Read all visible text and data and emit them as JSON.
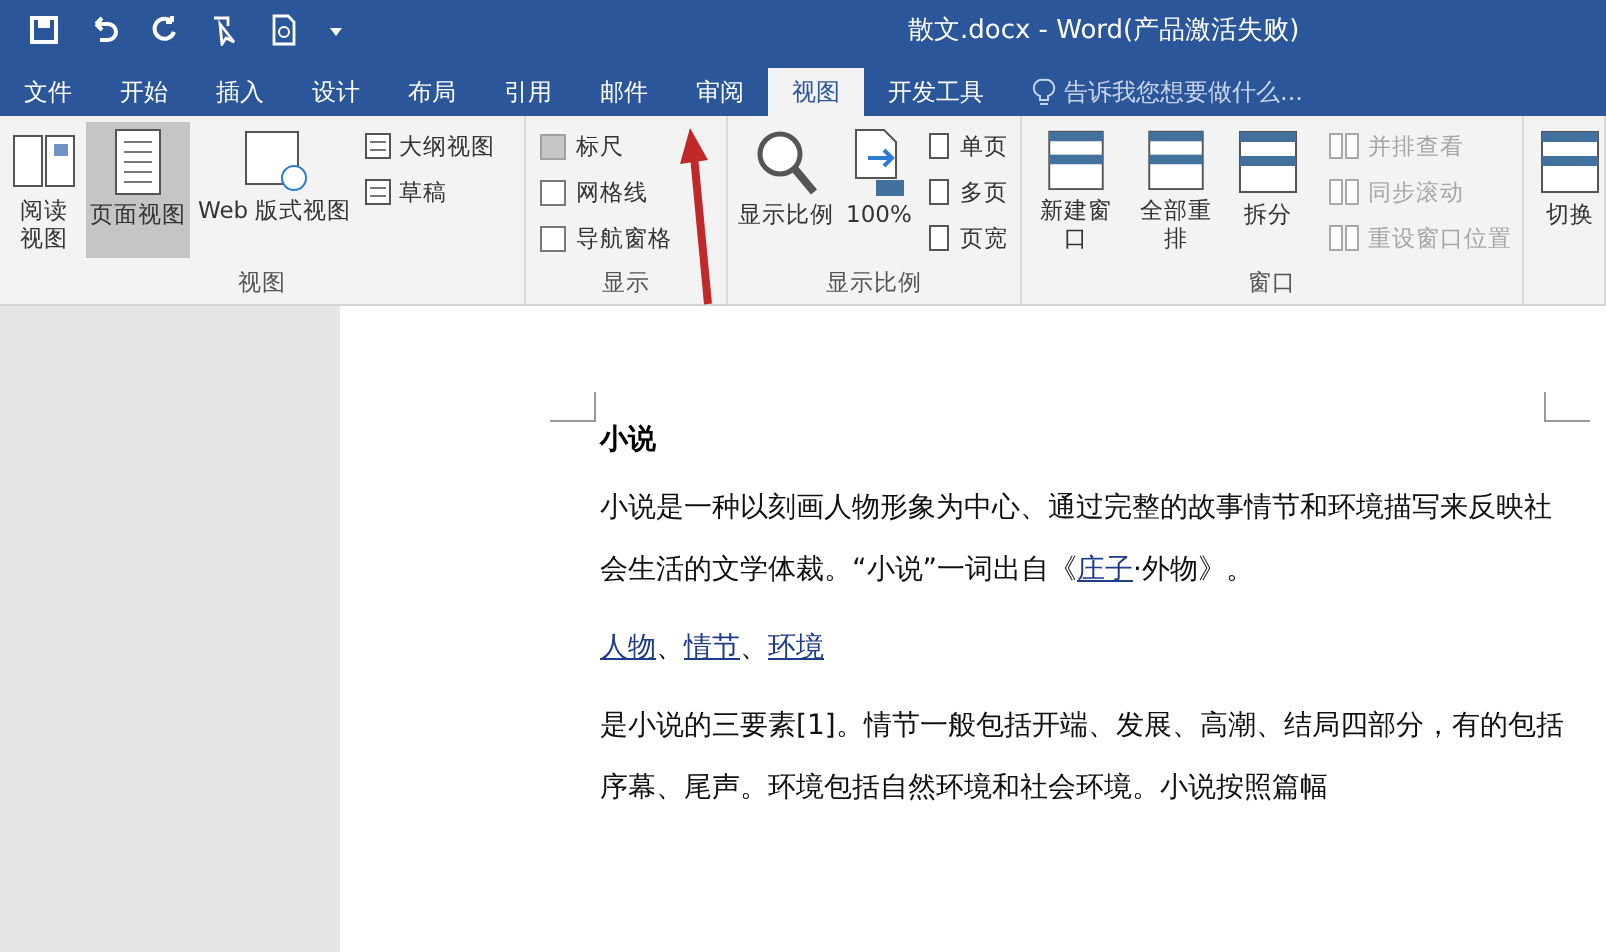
{
  "window": {
    "title": "散文.docx - Word(产品激活失败)"
  },
  "tabs": [
    {
      "label": "文件",
      "selected": false
    },
    {
      "label": "开始",
      "selected": false
    },
    {
      "label": "插入",
      "selected": false
    },
    {
      "label": "设计",
      "selected": false
    },
    {
      "label": "布局",
      "selected": false
    },
    {
      "label": "引用",
      "selected": false
    },
    {
      "label": "邮件",
      "selected": false
    },
    {
      "label": "审阅",
      "selected": false
    },
    {
      "label": "视图",
      "selected": true
    },
    {
      "label": "开发工具",
      "selected": false
    }
  ],
  "tell_me": {
    "placeholder": "告诉我您想要做什么..."
  },
  "ribbon": {
    "views": {
      "label": "视图",
      "large": [
        {
          "label": "阅读视图",
          "selected": false
        },
        {
          "label": "页面视图",
          "selected": true
        },
        {
          "label": "Web 版式视图",
          "selected": false
        }
      ],
      "small": [
        "大纲视图",
        "草稿"
      ]
    },
    "show": {
      "label": "显示",
      "checkboxes": [
        {
          "label": "标尺",
          "checked": false,
          "highlighted": true
        },
        {
          "label": "网格线",
          "checked": false,
          "highlighted": false
        },
        {
          "label": "导航窗格",
          "checked": false,
          "highlighted": false
        }
      ]
    },
    "zoom": {
      "label": "显示比例",
      "large": [
        "显示比例",
        "100%"
      ],
      "small": [
        "单页",
        "多页",
        "页宽"
      ]
    },
    "window": {
      "label": "窗口",
      "large": [
        "新建窗口",
        "全部重排",
        "拆分"
      ],
      "small": [
        {
          "label": "并排查看",
          "disabled": true
        },
        {
          "label": "同步滚动",
          "disabled": true
        },
        {
          "label": "重设窗口位置",
          "disabled": true
        }
      ],
      "switch": "切换"
    }
  },
  "document": {
    "heading": "小说",
    "paragraphs": [
      {
        "kind": "text",
        "parts": [
          {
            "text": "小说是一种以刻画人物形象为中心、通过完整的故事情节和环境描写来反映社会生活的文学体裁。“小说”一词出自《",
            "link": false
          },
          {
            "text": "庄子",
            "link": true
          },
          {
            "text": "·外物》。",
            "link": false
          }
        ]
      },
      {
        "kind": "text",
        "parts": [
          {
            "text": "人物",
            "link": true
          },
          {
            "text": "、",
            "link": false
          },
          {
            "text": "情节",
            "link": true
          },
          {
            "text": "、",
            "link": false
          },
          {
            "text": "环境",
            "link": true
          }
        ]
      },
      {
        "kind": "text",
        "parts": [
          {
            "text": "是小说的三要素[1]。情节一般包括开端、发展、高潮、结局四部分，有的包括序幕、尾声。环境包括自然环境和社会环境。小说按照篇幅",
            "link": false
          }
        ]
      }
    ]
  }
}
